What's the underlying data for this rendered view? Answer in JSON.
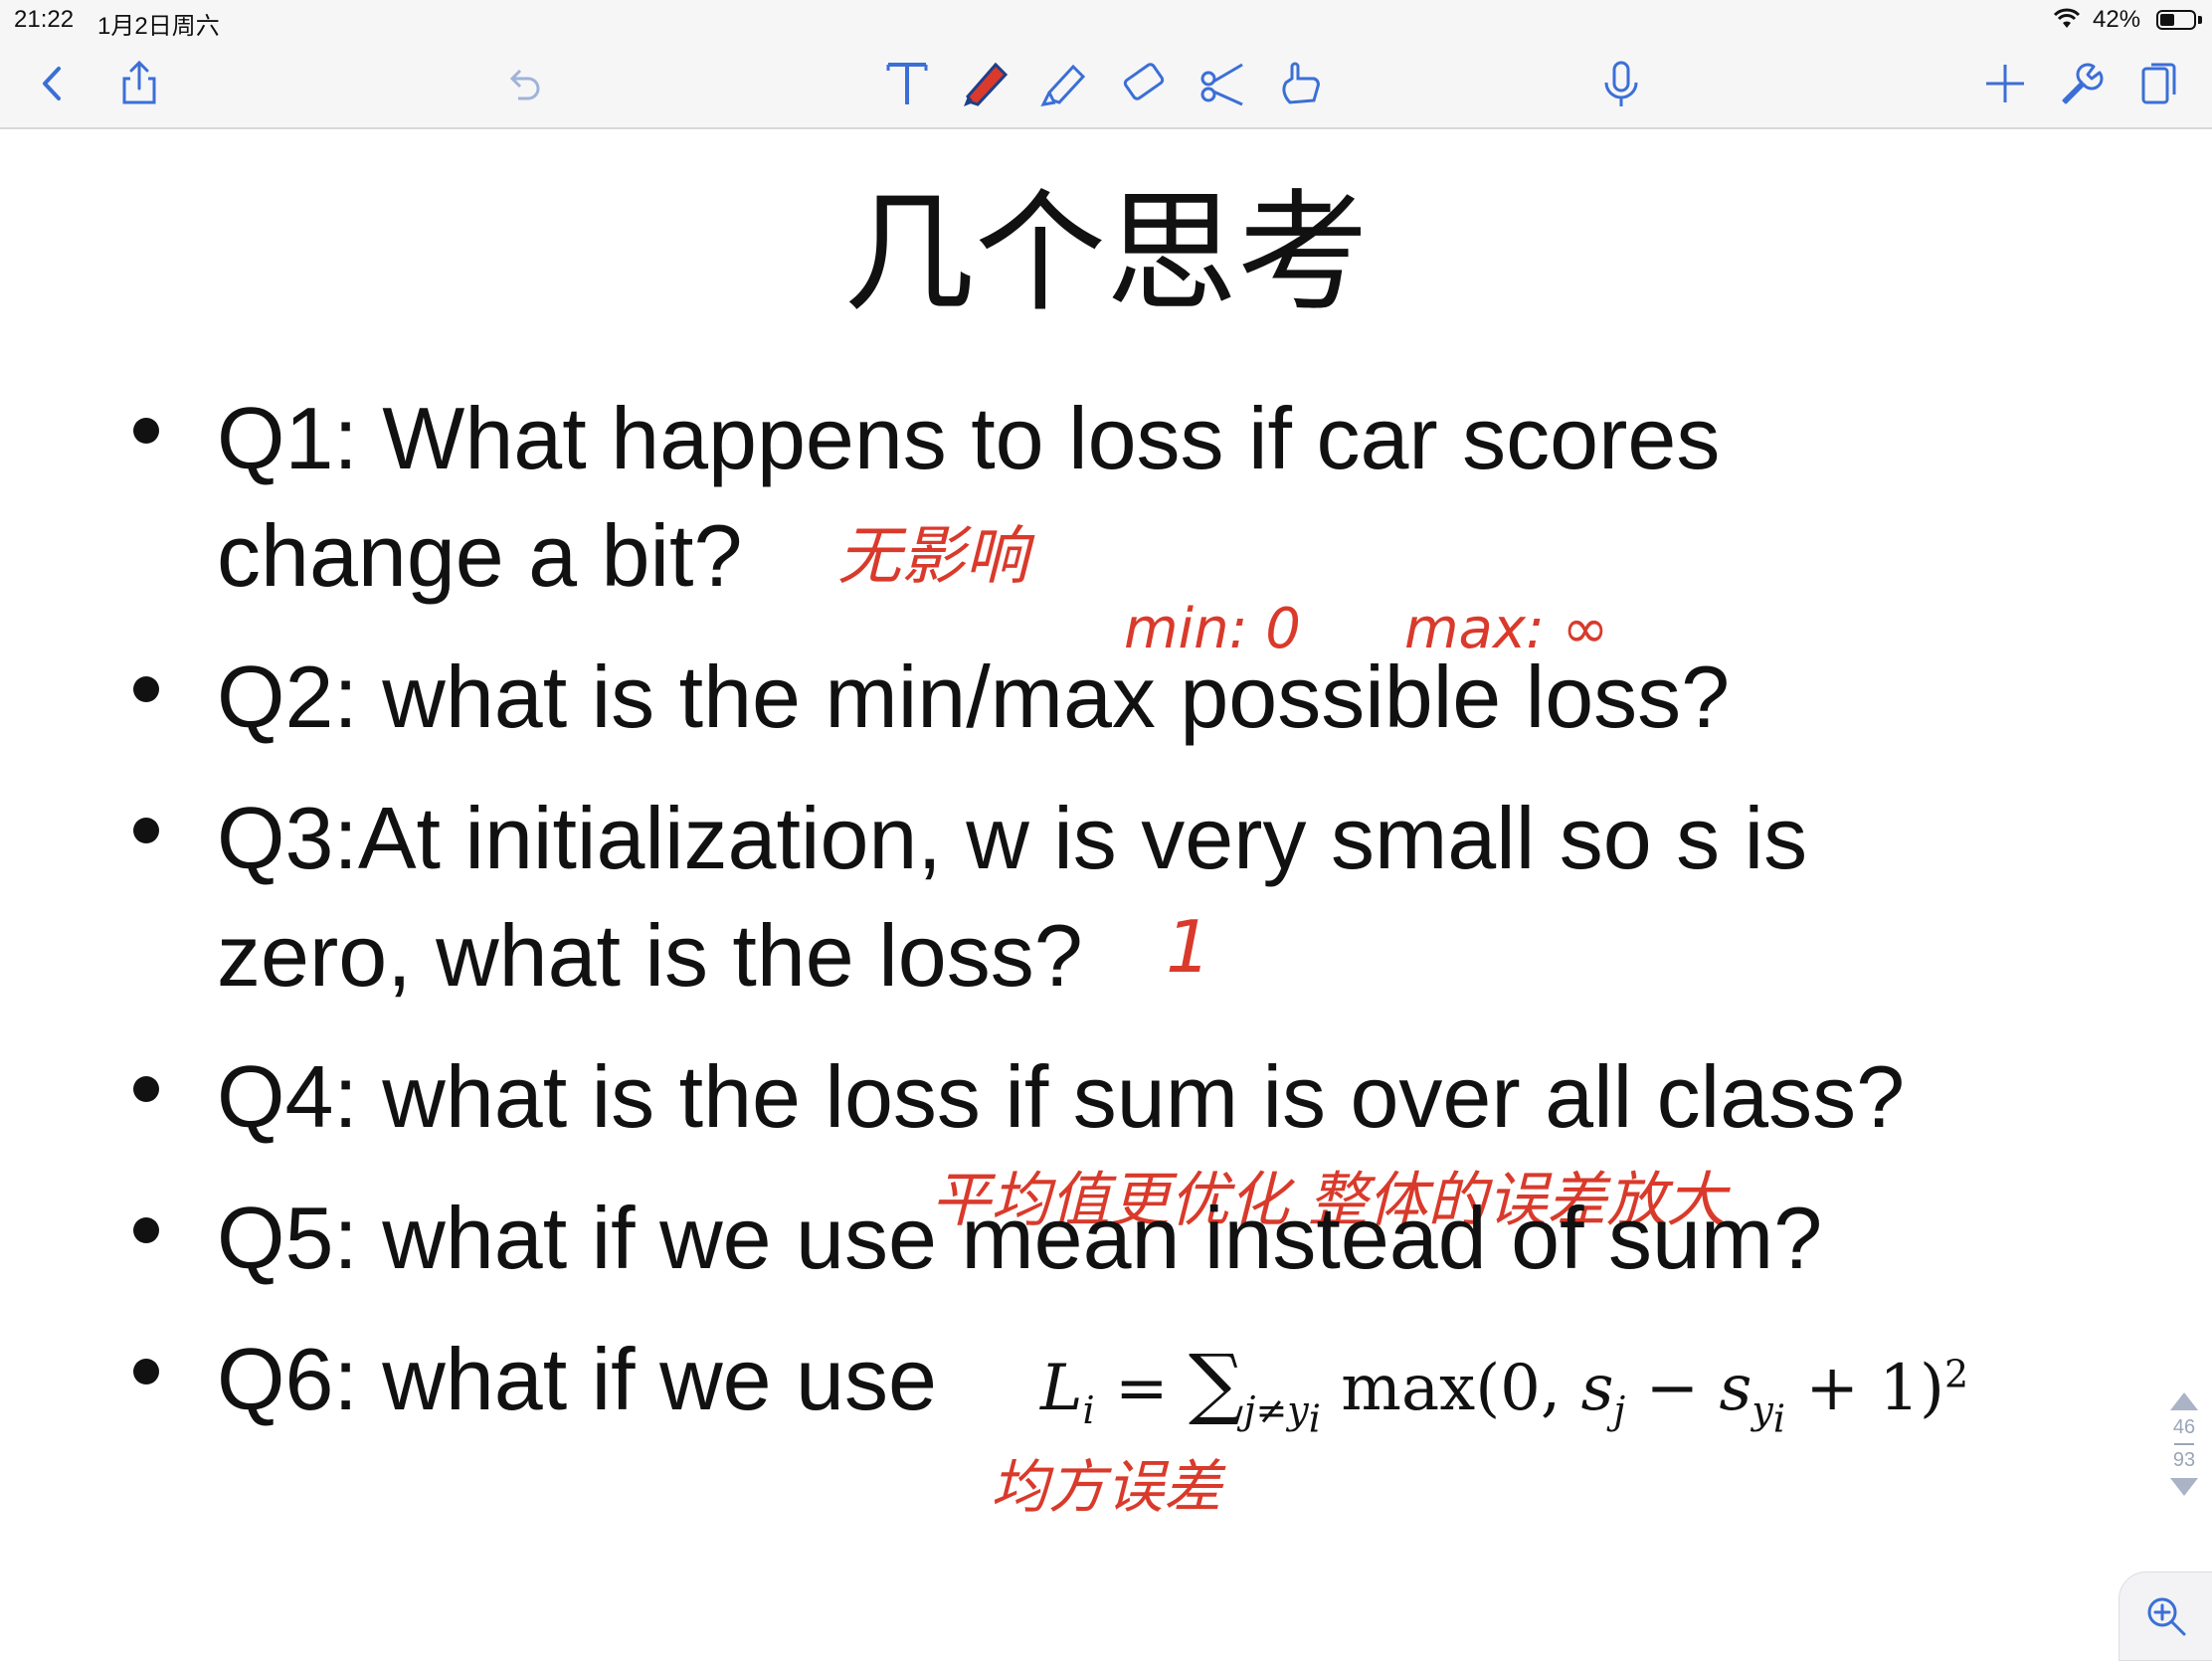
{
  "status_bar": {
    "time": "21:22",
    "date": "1月2日周六",
    "battery_percent": "42%",
    "battery_level": 0.42
  },
  "toolbar": {
    "icons": [
      "back-icon",
      "share-icon",
      "undo-icon",
      "text-tool-icon",
      "pen-icon",
      "highlighter-icon",
      "eraser-icon",
      "scissors-icon",
      "hand-icon",
      "microphone-icon",
      "add-icon",
      "wrench-icon",
      "pages-icon"
    ],
    "accent_color": "#3b6fd6",
    "pen_color": "#d93a2b"
  },
  "slide": {
    "title": "几个思考",
    "questions": [
      {
        "id": "q1_line1",
        "text": "Q1: What happens to loss if car scores"
      },
      {
        "id": "q1_line2",
        "text": "change a bit?"
      },
      {
        "id": "q2",
        "text": "Q2: what is the min/max possible loss?"
      },
      {
        "id": "q3_line1",
        "text": "Q3:At initialization, w is very small so s is"
      },
      {
        "id": "q3_line2",
        "text": "zero, what is the loss?"
      },
      {
        "id": "q4",
        "text": "Q4: what is the loss if sum is over all class?"
      },
      {
        "id": "q5",
        "text": "Q5: what if we use mean instead of sum?"
      },
      {
        "id": "q6",
        "text": "Q6: what if we use"
      }
    ],
    "formula": {
      "lhs": "L",
      "lhs_sub": "i",
      "equals": " = ",
      "sum": "∑",
      "sum_sub": "j≠y",
      "sum_sub_sub": "i",
      "body_pre": " max(0, ",
      "s": "s",
      "s_sub_j": "j",
      "minus": " − ",
      "s2": "s",
      "s2_sub": "y",
      "s2_sub_sub": "i",
      "body_post": " + 1)",
      "power": "2"
    }
  },
  "annotations": {
    "a1": "无影响",
    "a2_min": "min: 0",
    "a2_max": "max: ∞",
    "a3": "1",
    "a5": "平均值更优化 整体的误差放大",
    "a6": "均方误差"
  },
  "pager": {
    "current": "46",
    "total": "93"
  }
}
